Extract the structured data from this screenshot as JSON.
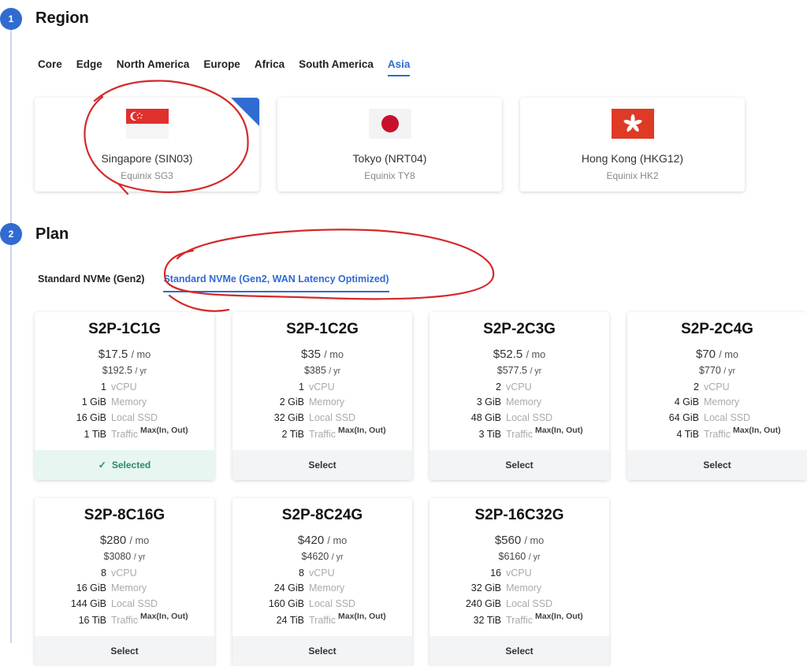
{
  "steps": {
    "region": {
      "number": "1",
      "title": "Region"
    },
    "plan": {
      "number": "2",
      "title": "Plan"
    }
  },
  "region_tabs": [
    "Core",
    "Edge",
    "North America",
    "Europe",
    "Africa",
    "South America",
    "Asia"
  ],
  "region_tabs_active": "Asia",
  "regions": [
    {
      "name": "Singapore (SIN03)",
      "datacenter": "Equinix SG3",
      "flag": "singapore-flag-icon",
      "selected": true
    },
    {
      "name": "Tokyo (NRT04)",
      "datacenter": "Equinix TY8",
      "flag": "japan-flag-icon",
      "selected": false
    },
    {
      "name": "Hong Kong (HKG12)",
      "datacenter": "Equinix HK2",
      "flag": "hong-kong-flag-icon",
      "selected": false
    }
  ],
  "plan_tabs": [
    "Standard NVMe (Gen2)",
    "Standard NVMe (Gen2, WAN Latency Optimized)"
  ],
  "plan_tabs_active": "Standard NVMe (Gen2, WAN Latency Optimized)",
  "units": {
    "mo": "/ mo",
    "yr": "/ yr"
  },
  "spec_labels": {
    "vcpu": "vCPU",
    "memory": "Memory",
    "ssd": "Local SSD",
    "traffic": "Traffic",
    "traffic_note": "Max(In, Out)"
  },
  "plans": [
    {
      "name": "S2P-1C1G",
      "price_mo": "$17.5",
      "price_yr": "$192.5",
      "vcpu": "1",
      "memory": "1 GiB",
      "ssd": "16 GiB",
      "traffic": "1 TiB",
      "action": "Selected",
      "selected": true
    },
    {
      "name": "S2P-1C2G",
      "price_mo": "$35",
      "price_yr": "$385",
      "vcpu": "1",
      "memory": "2 GiB",
      "ssd": "32 GiB",
      "traffic": "2 TiB",
      "action": "Select",
      "selected": false
    },
    {
      "name": "S2P-2C3G",
      "price_mo": "$52.5",
      "price_yr": "$577.5",
      "vcpu": "2",
      "memory": "3 GiB",
      "ssd": "48 GiB",
      "traffic": "3 TiB",
      "action": "Select",
      "selected": false
    },
    {
      "name": "S2P-2C4G",
      "price_mo": "$70",
      "price_yr": "$770",
      "vcpu": "2",
      "memory": "4 GiB",
      "ssd": "64 GiB",
      "traffic": "4 TiB",
      "action": "Select",
      "selected": false
    },
    {
      "name": "S2P-8C16G",
      "price_mo": "$280",
      "price_yr": "$3080",
      "vcpu": "8",
      "memory": "16 GiB",
      "ssd": "144 GiB",
      "traffic": "16 TiB",
      "action": "Select",
      "selected": false
    },
    {
      "name": "S2P-8C24G",
      "price_mo": "$420",
      "price_yr": "$4620",
      "vcpu": "8",
      "memory": "24 GiB",
      "ssd": "160 GiB",
      "traffic": "24 TiB",
      "action": "Select",
      "selected": false
    },
    {
      "name": "S2P-16C32G",
      "price_mo": "$560",
      "price_yr": "$6160",
      "vcpu": "16",
      "memory": "32 GiB",
      "ssd": "240 GiB",
      "traffic": "32 TiB",
      "action": "Select",
      "selected": false
    }
  ],
  "colors": {
    "accent": "#2f6bd1",
    "selected_bg": "#e7f6f1",
    "selected_text": "#2b8a63",
    "annotation": "#d42a2a"
  }
}
